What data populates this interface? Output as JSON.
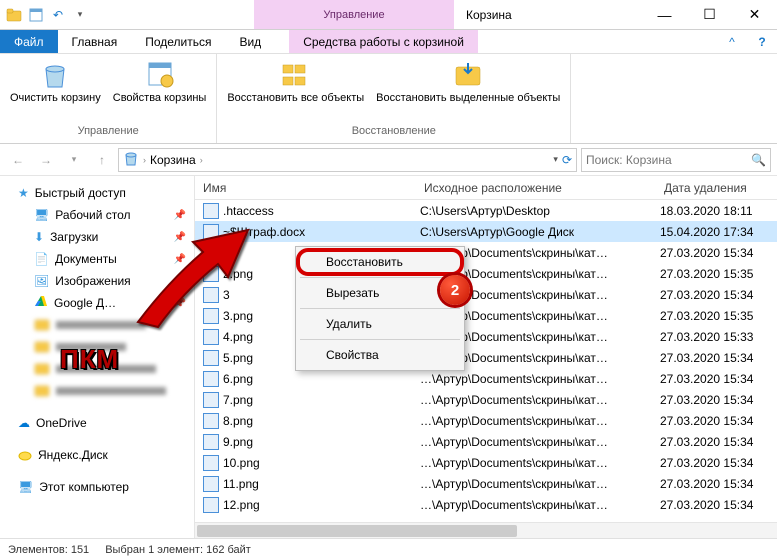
{
  "window": {
    "title": "Корзина",
    "context_tab": "Управление",
    "context_sub": "Средства работы с корзиной"
  },
  "tabs": {
    "file": "Файл",
    "home": "Главная",
    "share": "Поделиться",
    "view": "Вид"
  },
  "ribbon": {
    "group1_label": "Управление",
    "empty_bin": "Очистить корзину",
    "bin_props": "Свойства корзины",
    "group2_label": "Восстановление",
    "restore_all": "Восстановить все объекты",
    "restore_sel": "Восстановить выделенные объекты"
  },
  "breadcrumb": {
    "root": "Корзина"
  },
  "search": {
    "placeholder": "Поиск: Корзина"
  },
  "nav": {
    "quick": "Быстрый доступ",
    "desktop": "Рабочий стол",
    "downloads": "Загрузки",
    "documents": "Документы",
    "pictures": "Изображения",
    "gdrive": "Google Д…",
    "onedrive": "OneDrive",
    "yandex": "Яндекс.Диск",
    "thispc": "Этот компьютер"
  },
  "annotation": {
    "pkm": "ПКМ"
  },
  "columns": {
    "name": "Имя",
    "location": "Исходное расположение",
    "date": "Дата удаления"
  },
  "selected_index": 1,
  "files": [
    {
      "name": ".htaccess",
      "loc": "C:\\Users\\Артур\\Desktop",
      "date": "18.03.2020 18:11"
    },
    {
      "name": "~$Штраф.docx",
      "loc": "C:\\Users\\Артур\\Google Диск",
      "date": "15.04.2020 17:34"
    },
    {
      "name": "2",
      "loc": "…\\Артур\\Documents\\скрины\\кат…",
      "date": "27.03.2020 15:34"
    },
    {
      "name": "2.png",
      "loc": "…\\Артур\\Documents\\скрины\\кат…",
      "date": "27.03.2020 15:35"
    },
    {
      "name": "3",
      "loc": "…\\Артур\\Documents\\скрины\\кат…",
      "date": "27.03.2020 15:34"
    },
    {
      "name": "3.png",
      "loc": "…\\Артур\\Documents\\скрины\\кат…",
      "date": "27.03.2020 15:35"
    },
    {
      "name": "4.png",
      "loc": "…\\Артур\\Documents\\скрины\\кат…",
      "date": "27.03.2020 15:33"
    },
    {
      "name": "5.png",
      "loc": "…\\Артур\\Documents\\скрины\\кат…",
      "date": "27.03.2020 15:34"
    },
    {
      "name": "6.png",
      "loc": "…\\Артур\\Documents\\скрины\\кат…",
      "date": "27.03.2020 15:34"
    },
    {
      "name": "7.png",
      "loc": "…\\Артур\\Documents\\скрины\\кат…",
      "date": "27.03.2020 15:34"
    },
    {
      "name": "8.png",
      "loc": "…\\Артур\\Documents\\скрины\\кат…",
      "date": "27.03.2020 15:34"
    },
    {
      "name": "9.png",
      "loc": "…\\Артур\\Documents\\скрины\\кат…",
      "date": "27.03.2020 15:34"
    },
    {
      "name": "10.png",
      "loc": "…\\Артур\\Documents\\скрины\\кат…",
      "date": "27.03.2020 15:34"
    },
    {
      "name": "11.png",
      "loc": "…\\Артур\\Documents\\скрины\\кат…",
      "date": "27.03.2020 15:34"
    },
    {
      "name": "12.png",
      "loc": "…\\Артур\\Documents\\скрины\\кат…",
      "date": "27.03.2020 15:34"
    }
  ],
  "context_menu": {
    "restore": "Восстановить",
    "cut": "Вырезать",
    "delete": "Удалить",
    "props": "Свойства",
    "badge": "2"
  },
  "status": {
    "count": "Элементов: 151",
    "selection": "Выбран 1 элемент: 162 байт"
  }
}
